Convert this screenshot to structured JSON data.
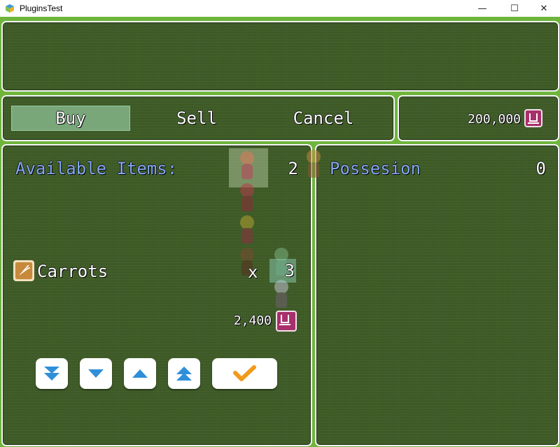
{
  "window": {
    "title": "PluginsTest",
    "minimize_glyph": "—",
    "maximize_glyph": "☐",
    "close_glyph": "✕"
  },
  "commands": {
    "buy": "Buy",
    "sell": "Sell",
    "cancel": "Cancel",
    "selected": "Buy"
  },
  "gold": {
    "amount": "200,000",
    "icon": "gold-pouch-icon"
  },
  "available": {
    "label": "Available Items:",
    "count": "2"
  },
  "possession": {
    "label": "Possesion",
    "count": "0"
  },
  "item": {
    "name": "Carrots",
    "icon": "carrot-icon",
    "times": "x",
    "quantity": "3",
    "price": "2,400"
  },
  "buttons": {
    "confirm_icon": "checkmark-icon"
  },
  "colors": {
    "system_text": "#84a9f0",
    "window_fill": "#3f5c27",
    "selection": "#aae6be"
  }
}
